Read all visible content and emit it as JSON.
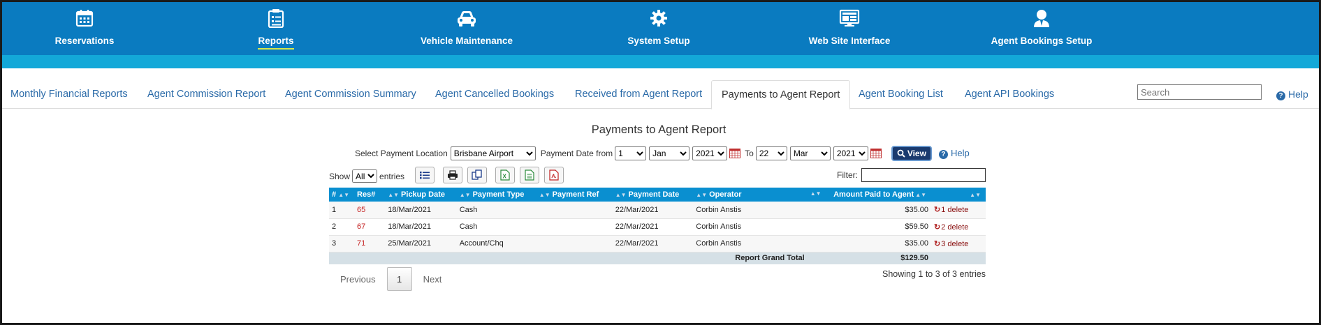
{
  "nav": {
    "items": [
      {
        "label": "Reservations",
        "icon": "calendar-icon"
      },
      {
        "label": "Reports",
        "icon": "clipboard-icon",
        "active": true
      },
      {
        "label": "Vehicle Maintenance",
        "icon": "car-icon"
      },
      {
        "label": "System Setup",
        "icon": "gear-icon"
      },
      {
        "label": "Web Site Interface",
        "icon": "monitor-icon"
      },
      {
        "label": "Agent Bookings Setup",
        "icon": "agent-icon"
      }
    ],
    "active_underline_color": "#d7e84a",
    "background": "#0a7bc0"
  },
  "tabs": {
    "items": [
      "Monthly Financial Reports",
      "Agent Commission Report",
      "Agent Commission Summary",
      "Agent Cancelled Bookings",
      "Received from Agent Report",
      "Payments to Agent Report",
      "Agent Booking List",
      "Agent API Bookings"
    ],
    "active": "Payments to Agent Report",
    "search_placeholder": "Search",
    "help": "Help"
  },
  "report": {
    "title": "Payments to Agent Report",
    "location_label": "Select Payment Location",
    "location_value": "Brisbane Airport",
    "date_from_label": "Payment Date from",
    "from_day": "1",
    "from_month": "Jan",
    "from_year": "2021",
    "to_label": "To",
    "to_day": "22",
    "to_month": "Mar",
    "to_year": "2021",
    "view_label": "View",
    "help_label": "Help"
  },
  "toolbar": {
    "show_label": "Show",
    "show_value": "All",
    "entries_label": "entries",
    "filter_label": "Filter:",
    "buttons": [
      "list-icon",
      "print-icon",
      "copy-icon",
      "excel-icon",
      "csv-icon",
      "pdf-icon"
    ]
  },
  "table": {
    "columns": [
      "#",
      "Res#",
      "Pickup Date",
      "Payment Type",
      "Payment Ref",
      "Payment Date",
      "Operator",
      "Amount Paid to Agent",
      ""
    ],
    "rows": [
      {
        "n": "1",
        "res": "65",
        "pickup": "18/Mar/2021",
        "type": "Cash",
        "ref": "",
        "paydate": "22/Mar/2021",
        "operator": "Corbin Anstis",
        "amount": "$35.00",
        "action": "1 delete"
      },
      {
        "n": "2",
        "res": "67",
        "pickup": "18/Mar/2021",
        "type": "Cash",
        "ref": "",
        "paydate": "22/Mar/2021",
        "operator": "Corbin Anstis",
        "amount": "$59.50",
        "action": "2 delete"
      },
      {
        "n": "3",
        "res": "71",
        "pickup": "25/Mar/2021",
        "type": "Account/Chq",
        "ref": "",
        "paydate": "22/Mar/2021",
        "operator": "Corbin Anstis",
        "amount": "$35.00",
        "action": "3 delete"
      }
    ],
    "total_label": "Report Grand Total",
    "total_value": "$129.50"
  },
  "pager": {
    "previous": "Previous",
    "current": "1",
    "next": "Next",
    "showing": "Showing 1 to 3 of 3 entries"
  }
}
